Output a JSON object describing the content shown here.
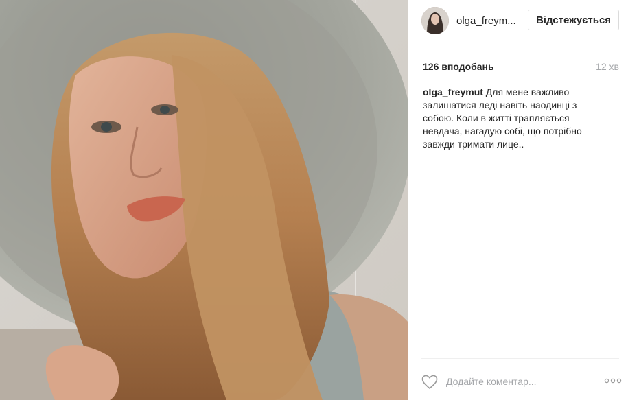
{
  "post": {
    "image_alt": "Portrait of a woman with long blonde hair wearing a wide grey sun hat",
    "username": "olga_freym...",
    "follow_label": "Відстежується",
    "likes": "126 вподобань",
    "time": "12 хв",
    "caption": {
      "username": "olga_freymut",
      "text": " Для мене важливо залишатися леді навіть наодинці з собою. Коли в житті трапляється невдача, нагадую собі, що потрібно завжди тримати лице.."
    },
    "comment_placeholder": "Додайте коментар...",
    "icons": {
      "like": "heart-icon",
      "more": "more-options-icon"
    }
  }
}
